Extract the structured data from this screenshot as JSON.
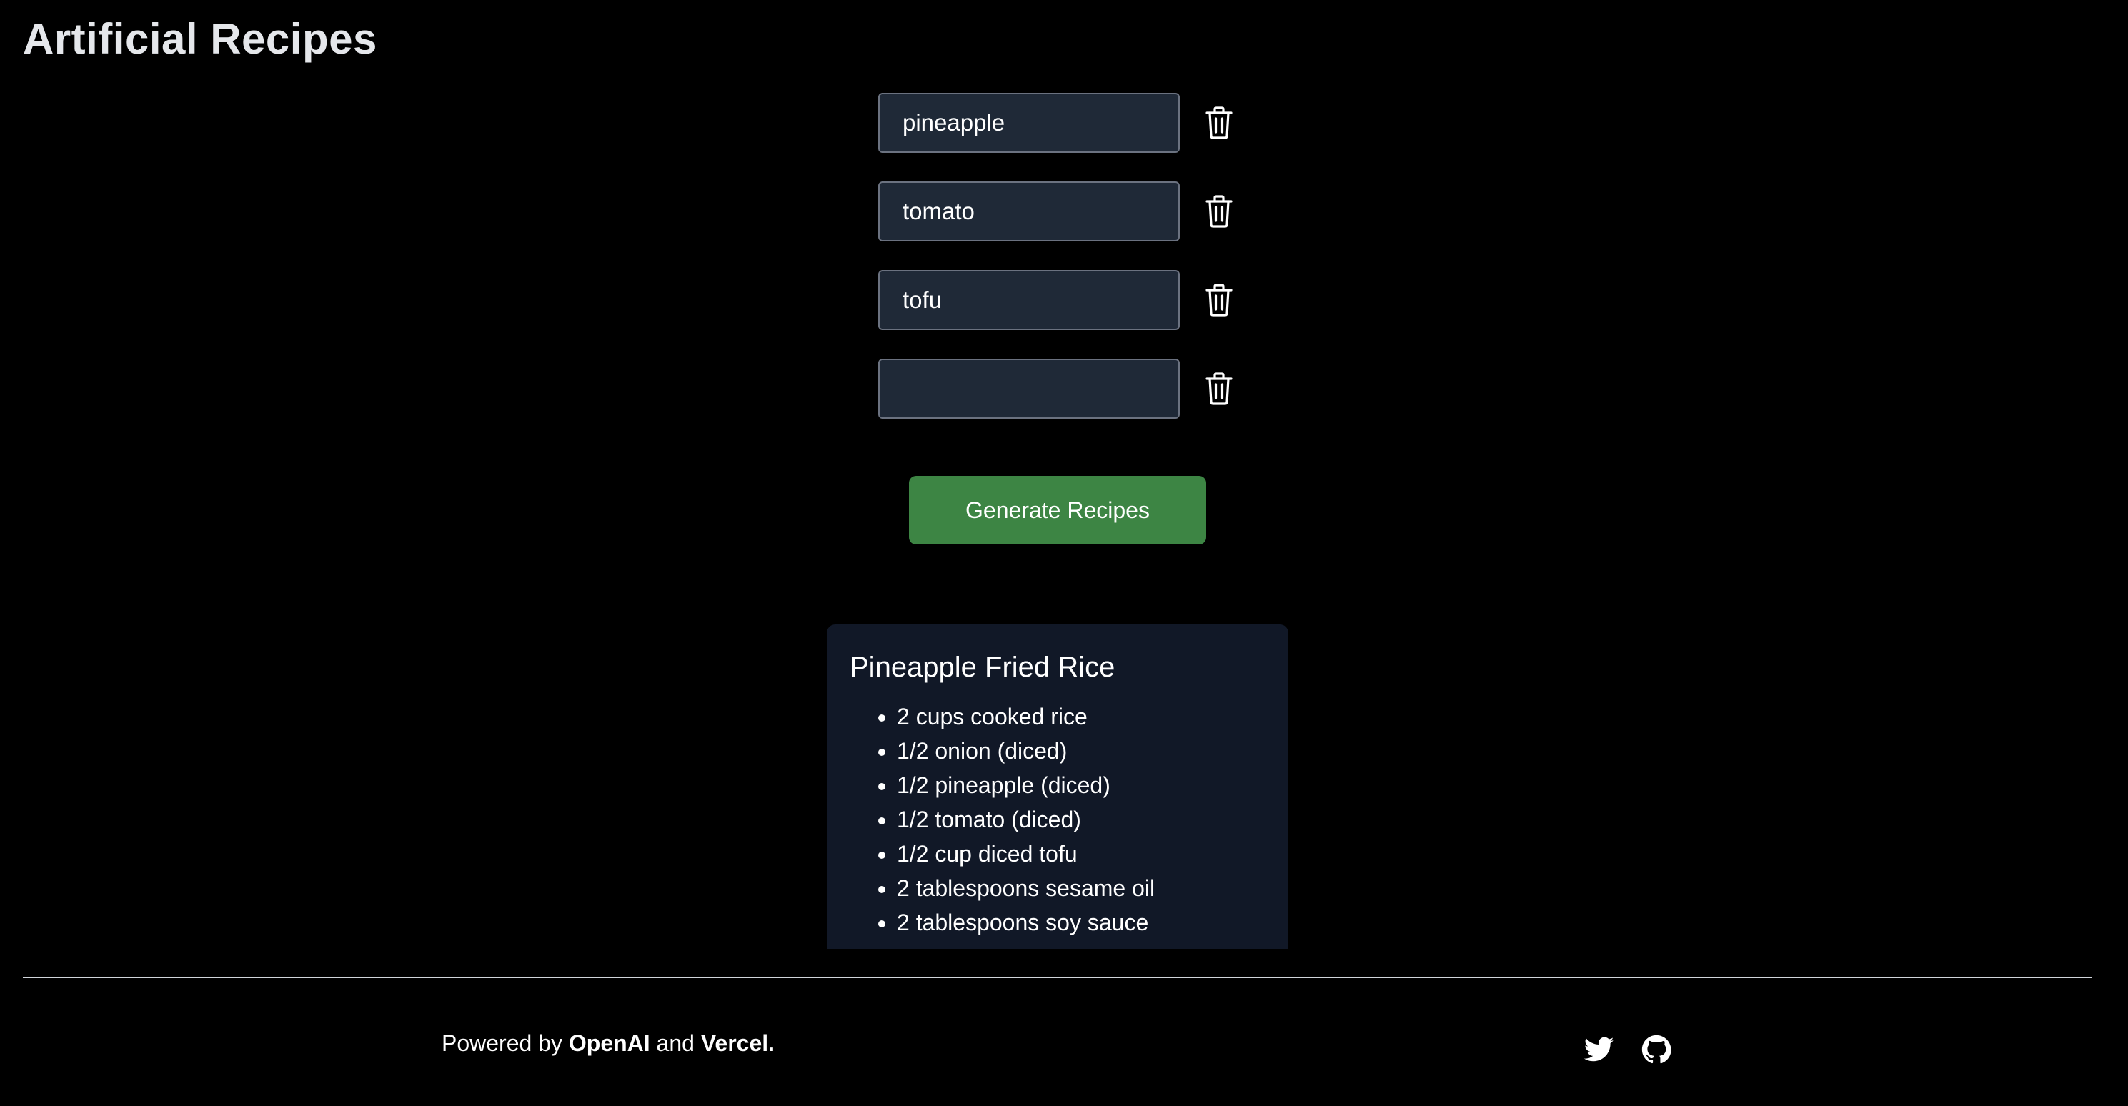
{
  "app": {
    "title": "Artificial Recipes"
  },
  "ingredients": [
    {
      "value": "pineapple",
      "placeholder": ""
    },
    {
      "value": "tomato",
      "placeholder": ""
    },
    {
      "value": "tofu",
      "placeholder": ""
    },
    {
      "value": "",
      "placeholder": ""
    }
  ],
  "actions": {
    "generate_label": "Generate Recipes",
    "delete_icon": "trash-icon"
  },
  "recipe": {
    "title": "Pineapple Fried Rice",
    "items": [
      "2 cups cooked rice",
      "1/2 onion (diced)",
      "1/2 pineapple (diced)",
      "1/2 tomato (diced)",
      "1/2 cup diced tofu",
      "2 tablespoons sesame oil",
      "2 tablespoons soy sauce"
    ]
  },
  "footer": {
    "powered_by": "Powered by",
    "openai": "OpenAI",
    "and": "and",
    "vercel": "Vercel.",
    "social_icons": [
      "twitter-icon",
      "github-icon"
    ]
  },
  "colors": {
    "background": "#000000",
    "accent_green": "#3d8544",
    "input_background": "#1f2937",
    "card_background": "#111827"
  }
}
